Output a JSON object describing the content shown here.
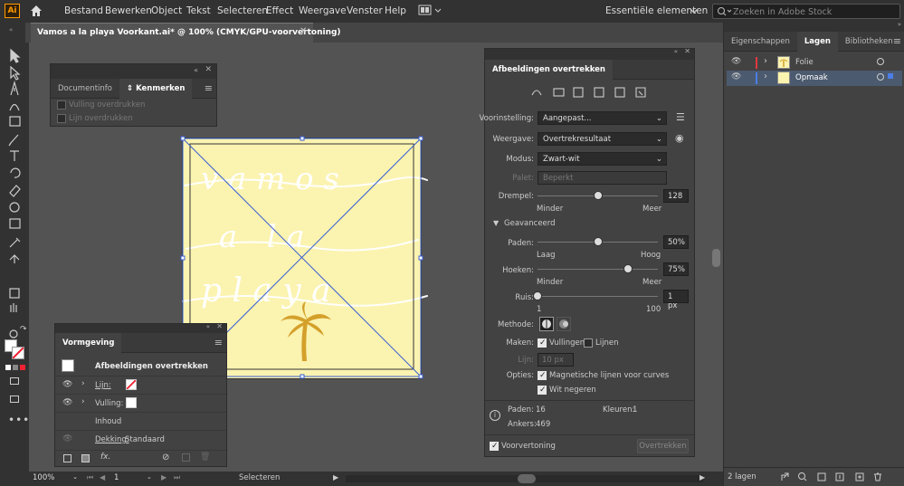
{
  "app": {
    "logo": "Ai"
  },
  "menu": [
    "Bestand",
    "Bewerken",
    "Object",
    "Tekst",
    "Selecteren",
    "Effect",
    "Weergave",
    "Venster",
    "Help"
  ],
  "workspace": "Essentiële elementen",
  "search_placeholder": "Zoeken in Adobe Stock",
  "document_tab": "Vamos a la playa Voorkant.ai* @ 100% (CMYK/GPU-voorvertoning)",
  "docinfo": {
    "tabs": [
      "Documentinfo",
      "Kenmerken"
    ],
    "overprint_fill": "Vulling overdrukken",
    "overprint_stroke": "Lijn overdrukken"
  },
  "appearance": {
    "title": "Vormgeving",
    "object": "Afbeeldingen overtrekken",
    "stroke_label": "Lijn:",
    "fill_label": "Vulling:",
    "content": "Inhoud",
    "opacity_label": "Dekking:",
    "opacity_value": "Standaard",
    "fx": "fx."
  },
  "artwork": {
    "words": [
      "v a m o s",
      "a   l a",
      "p l a y a"
    ],
    "bg": "#fbf3b0",
    "palm_color": "#d4a02a"
  },
  "trace": {
    "title": "Afbeeldingen overtrekken",
    "preset_label": "Voorinstelling:",
    "preset_value": "Aangepast...",
    "view_label": "Weergave:",
    "view_value": "Overtrekresultaat",
    "mode_label": "Modus:",
    "mode_value": "Zwart-wit",
    "palette_label": "Palet:",
    "palette_value": "Beperkt",
    "threshold_label": "Drempel:",
    "threshold_value": "128",
    "threshold_level": 0.5,
    "threshold_min": "Minder",
    "threshold_max": "Meer",
    "advanced": "Geavanceerd",
    "paths_label": "Paden:",
    "paths_value": "50%",
    "paths_level": 0.5,
    "paths_min": "Laag",
    "paths_max": "Hoog",
    "corners_label": "Hoeken:",
    "corners_value": "75%",
    "corners_level": 0.75,
    "corners_min": "Minder",
    "corners_max": "Meer",
    "noise_label": "Ruis:",
    "noise_value": "1 px",
    "noise_level": 0,
    "noise_min": "1",
    "noise_max": "100",
    "method_label": "Methode:",
    "create_label": "Maken:",
    "fills": "Vullingen",
    "strokes": "Lijnen",
    "stroke_label": "Lijn:",
    "stroke_value": "10 px",
    "options_label": "Opties:",
    "snap": "Magnetische lijnen voor curves",
    "ignore_white": "Wit negeren",
    "stat_paths_label": "Paden:",
    "stat_paths": "16",
    "stat_colors_label": "Kleuren:",
    "stat_colors": "1",
    "stat_anchors_label": "Ankers:",
    "stat_anchors": "469",
    "preview": "Voorvertoning",
    "trace_button": "Overtrekken"
  },
  "layers": {
    "tabs": [
      "Eigenschappen",
      "Lagen",
      "Bibliotheken"
    ],
    "items": [
      {
        "name": "Folie",
        "color": "#e0393e"
      },
      {
        "name": "Opmaak",
        "color": "#4c7ee8"
      }
    ],
    "count": "2 lagen"
  },
  "status": {
    "zoom": "100%",
    "artboard": "1",
    "tool": "Selecteren"
  }
}
